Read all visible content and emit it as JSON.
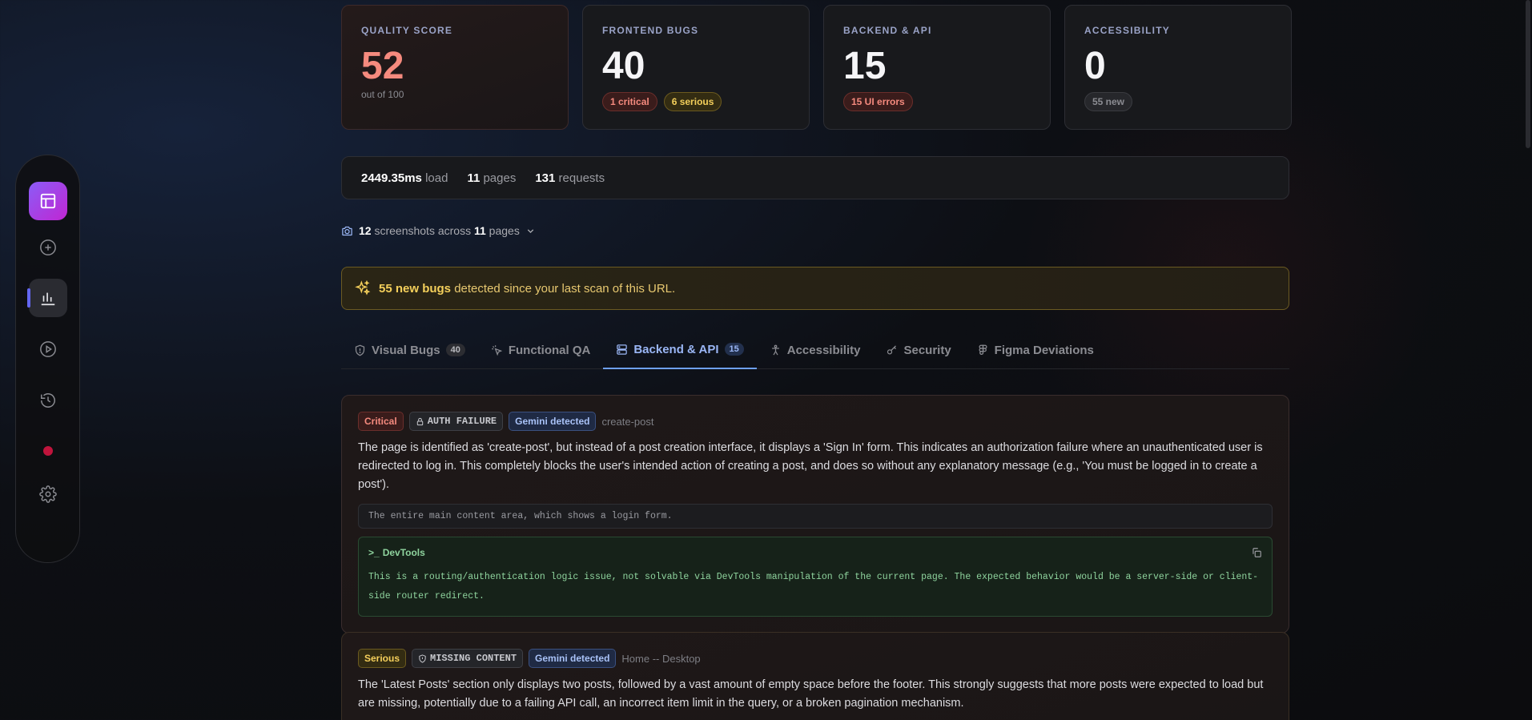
{
  "cards": [
    {
      "label": "QUALITY SCORE",
      "value": "52",
      "sub": "out of 100",
      "pills": []
    },
    {
      "label": "FRONTEND BUGS",
      "value": "40",
      "sub": "",
      "pills": [
        "1 critical",
        "6 serious"
      ]
    },
    {
      "label": "BACKEND & API",
      "value": "15",
      "sub": "",
      "pills": [
        "15 UI errors"
      ]
    },
    {
      "label": "ACCESSIBILITY",
      "value": "0",
      "sub": "",
      "pills": [
        "55 new"
      ]
    }
  ],
  "stats": {
    "load_value": "2449.35ms",
    "load_label": "load",
    "pages_value": "11",
    "pages_label": "pages",
    "requests_value": "131",
    "requests_label": "requests"
  },
  "screenshots": {
    "count": "12",
    "text": "screenshots across",
    "pages": "11",
    "pages_label": "pages"
  },
  "banner": {
    "strong": "55 new bugs",
    "text": "detected since your last scan of this URL."
  },
  "tabs": [
    {
      "label": "Visual Bugs",
      "badge": "40",
      "icon": "shield-icon"
    },
    {
      "label": "Functional QA",
      "badge": "",
      "icon": "sparkle-cursor-icon"
    },
    {
      "label": "Backend & API",
      "badge": "15",
      "icon": "server-icon",
      "active": true
    },
    {
      "label": "Accessibility",
      "badge": "",
      "icon": "accessibility-icon"
    },
    {
      "label": "Security",
      "badge": "",
      "icon": "key-icon"
    },
    {
      "label": "Figma Deviations",
      "badge": "",
      "icon": "figma-icon"
    }
  ],
  "issues": [
    {
      "severity": "Critical",
      "kind": "AUTH FAILURE",
      "source": "Gemini detected",
      "location": "create-post",
      "description": "The page is identified as 'create-post', but instead of a post creation interface, it displays a 'Sign In' form. This indicates an authorization failure where an unauthenticated user is redirected to log in. This completely blocks the user's intended action of creating a post, and does so without any explanatory message (e.g., 'You must be logged in to create a post').",
      "selector": "The entire main content area, which shows a login form.",
      "devtools_title": "DevTools",
      "devtools_body": "This is a routing/authentication logic issue, not solvable via DevTools manipulation of the current page. The expected behavior would be a server-side or client-side router redirect."
    },
    {
      "severity": "Serious",
      "kind": "MISSING CONTENT",
      "source": "Gemini detected",
      "location": "Home -- Desktop",
      "description": "The 'Latest Posts' section only displays two posts, followed by a vast amount of empty space before the footer. This strongly suggests that more posts were expected to load but are missing, potentially due to a failing API call, an incorrect item limit in the query, or a broken pagination mechanism."
    }
  ],
  "colors": {
    "accent": "#6ea0f7",
    "critical": "#f58a7e",
    "serious": "#f4cf5b",
    "devtools": "#8fd49e",
    "brand_gradient_start": "#8b5cf6",
    "brand_gradient_end": "#c026d3"
  }
}
